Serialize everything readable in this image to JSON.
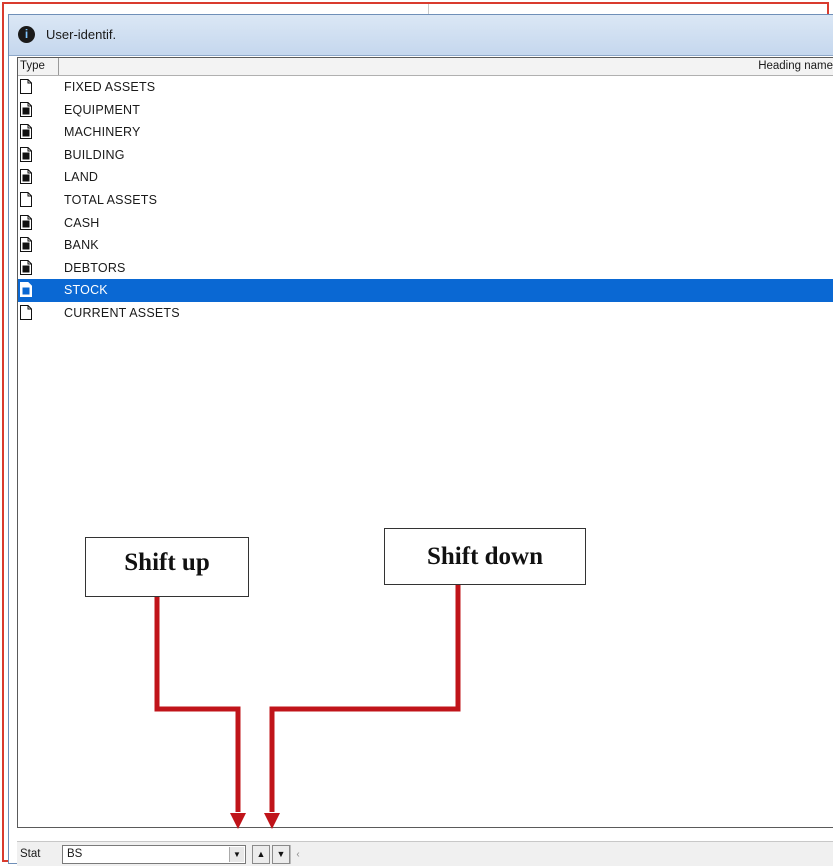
{
  "window": {
    "title": "User-identif.",
    "title_icon": "info-circle-icon"
  },
  "list": {
    "columns": {
      "type": "Type",
      "heading": "Heading name"
    },
    "rows": [
      {
        "label": "FIXED ASSETS",
        "icon": "document-icon",
        "filled": false
      },
      {
        "label": "EQUIPMENT",
        "icon": "document-filled-icon",
        "filled": true
      },
      {
        "label": "MACHINERY",
        "icon": "document-filled-icon",
        "filled": true
      },
      {
        "label": "BUILDING",
        "icon": "document-filled-icon",
        "filled": true
      },
      {
        "label": "LAND",
        "icon": "document-filled-icon",
        "filled": true
      },
      {
        "label": "TOTAL ASSETS",
        "icon": "document-icon",
        "filled": false
      },
      {
        "label": "CASH",
        "icon": "document-filled-icon",
        "filled": true
      },
      {
        "label": "BANK",
        "icon": "document-filled-icon",
        "filled": true
      },
      {
        "label": "DEBTORS",
        "icon": "document-filled-icon",
        "filled": true
      },
      {
        "label": "STOCK",
        "icon": "document-filled-icon",
        "filled": true,
        "selected": true
      },
      {
        "label": "CURRENT ASSETS",
        "icon": "document-icon",
        "filled": false
      }
    ]
  },
  "annotations": {
    "shift_up": "Shift up",
    "shift_down": "Shift down",
    "arrow_color": "#c0141a"
  },
  "statusbar": {
    "stat_label": "Stat",
    "stat_value": "BS",
    "shift_up_icon": "triangle-up-icon",
    "shift_down_icon": "triangle-down-icon",
    "scroll_left_icon": "chevron-left-icon"
  },
  "colors": {
    "selection": "#0a68d3",
    "frame": "#d93b2e"
  }
}
